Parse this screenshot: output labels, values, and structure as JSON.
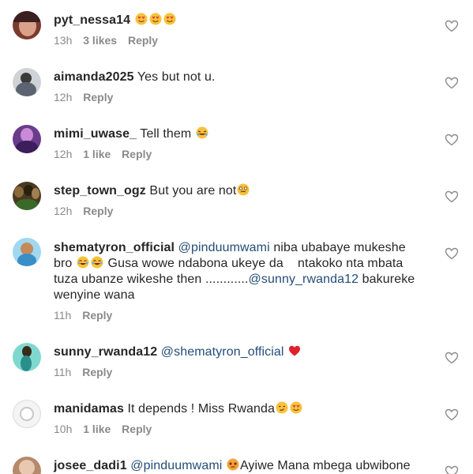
{
  "comments": [
    {
      "username": "pyt_nessa14",
      "text": "",
      "mention": "",
      "after_mention": "",
      "emojis": [
        "heart-eyes",
        "heart-eyes",
        "heart-eyes"
      ],
      "time": "13h",
      "likes": "3 likes",
      "reply": "Reply",
      "avatar_color": "#7a3b2e"
    },
    {
      "username": "aimanda2025",
      "text": "Yes but not u.",
      "mention": "",
      "after_mention": "",
      "emojis": [],
      "time": "12h",
      "likes": "",
      "reply": "Reply",
      "avatar_color": "#5b6470"
    },
    {
      "username": "mimi_uwase_",
      "text": "Tell them",
      "mention": "",
      "after_mention": "",
      "emojis": [
        "rofl"
      ],
      "time": "12h",
      "likes": "1 like",
      "reply": "Reply",
      "avatar_color": "#6a3c8c"
    },
    {
      "username": "step_town_ogz",
      "text": "But you are not",
      "mention": "",
      "after_mention": "",
      "emojis": [
        "woozy"
      ],
      "time": "12h",
      "likes": "",
      "reply": "Reply",
      "avatar_color": "#4a3a22"
    },
    {
      "username": "shematyron_official",
      "text": "",
      "mention": "@pinduumwami",
      "line1_rest": "niba ubabaye mukeshe",
      "line2": "bro",
      "line2_rest": "Gusa wowe ndabona ukeye da    ntakoko nta mbata",
      "line3": "tuza ubanze wikeshe then ............",
      "mention2": "@sunny_rwanda12",
      "line3_rest": "bakureke",
      "line4": "wenyine wana",
      "emojis": [
        "joy",
        "joy"
      ],
      "time": "11h",
      "likes": "",
      "reply": "Reply",
      "avatar_color": "#3b8fc7"
    },
    {
      "username": "sunny_rwanda12",
      "text": "",
      "mention": "@shematyron_official",
      "after_mention": "",
      "emojis": [
        "red-heart"
      ],
      "time": "11h",
      "likes": "",
      "reply": "Reply",
      "avatar_color": "#2a8f8a"
    },
    {
      "username": "manidamas",
      "text": "It depends ! Miss Rwanda",
      "mention": "",
      "after_mention": "",
      "emojis": [
        "smirk",
        "heart-eyes"
      ],
      "time": "10h",
      "likes": "1 like",
      "reply": "Reply",
      "avatar_color": "#d8d8d8"
    },
    {
      "username": "josee_dadi1",
      "text": "",
      "mention": "@pinduumwami",
      "after_mention": "Ayiwe Mana mbega ubwibone",
      "emojis": [
        "pleading"
      ],
      "time": "",
      "likes": "",
      "reply": "",
      "avatar_color": "#b58a6a"
    }
  ]
}
